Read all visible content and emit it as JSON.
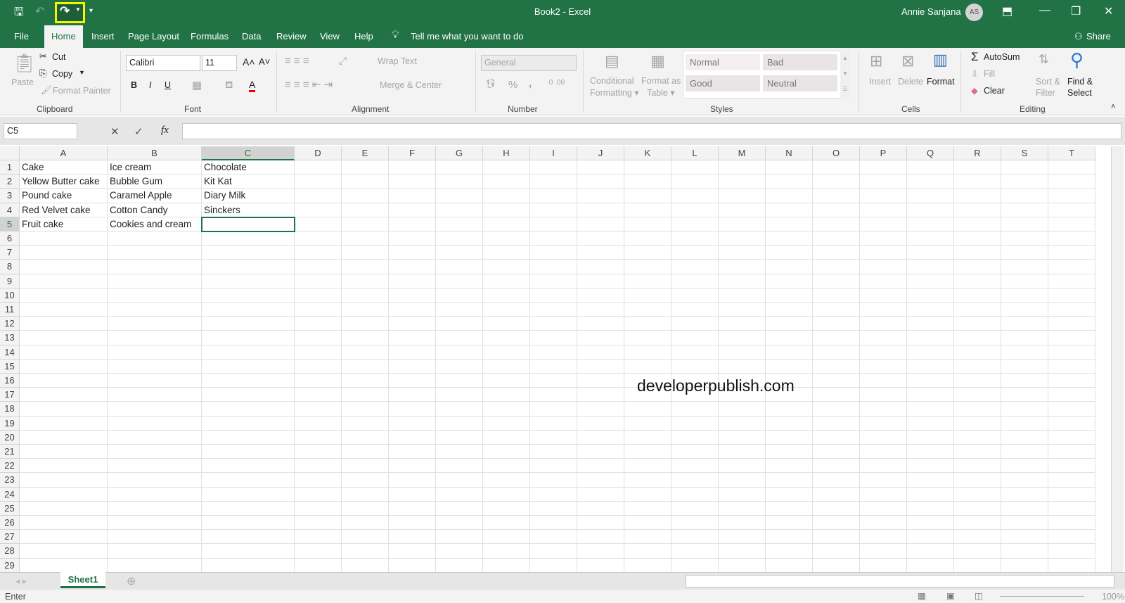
{
  "window": {
    "title": "Book2  -  Excel",
    "user": "Annie Sanjana",
    "initials": "AS",
    "accent": "#217346"
  },
  "qat": {
    "save": "save-icon",
    "undo": "undo-icon",
    "redo": "redo-icon",
    "customize": "▾"
  },
  "tabs": [
    "File",
    "Home",
    "Insert",
    "Page Layout",
    "Formulas",
    "Data",
    "Review",
    "View",
    "Help"
  ],
  "tell_me": "Tell me what you want to do",
  "share": "Share",
  "ribbon": {
    "clipboard": {
      "label": "Clipboard",
      "paste": "Paste",
      "cut": "Cut",
      "copy": "Copy",
      "format_painter": "Format Painter"
    },
    "font": {
      "label": "Font",
      "name": "Calibri",
      "size": "11",
      "bold": "B",
      "italic": "I",
      "underline": "U",
      "color_letter": "A"
    },
    "alignment": {
      "label": "Alignment",
      "wrap": "Wrap Text",
      "merge": "Merge & Center"
    },
    "number": {
      "label": "Number",
      "format": "General",
      "percent": "%",
      "comma": ","
    },
    "styles": {
      "label": "Styles",
      "conditional": "Conditional",
      "formatting": "Formatting ▾",
      "format_as": "Format as",
      "table": "Table ▾",
      "normal": "Normal",
      "bad": "Bad",
      "good": "Good",
      "neutral": "Neutral"
    },
    "cells": {
      "label": "Cells",
      "insert": "Insert",
      "delete": "Delete",
      "format": "Format"
    },
    "editing": {
      "label": "Editing",
      "autosum": "AutoSum",
      "fill": "Fill",
      "clear": "Clear",
      "sort1": "Sort &",
      "sort2": "Filter",
      "find1": "Find &",
      "find2": "Select"
    }
  },
  "formula_bar": {
    "name_box": "C5",
    "cancel": "✕",
    "enter": "✓",
    "fx": "fx",
    "value": ""
  },
  "columns": [
    "A",
    "B",
    "C",
    "D",
    "E",
    "F",
    "G",
    "H",
    "I",
    "J",
    "K",
    "L",
    "M",
    "N",
    "O",
    "P",
    "Q",
    "R",
    "S",
    "T"
  ],
  "rows": [
    [
      "Cake",
      "Ice cream",
      "Chocolate"
    ],
    [
      "Yellow Butter cake",
      "Bubble Gum",
      "Kit Kat"
    ],
    [
      "Pound cake",
      "Caramel Apple",
      "Diary Milk"
    ],
    [
      "Red Velvet cake",
      "Cotton Candy",
      "Sinckers"
    ],
    [
      "Fruit cake",
      "Cookies and cream",
      ""
    ]
  ],
  "row_count": 29,
  "selected_cell": "C5",
  "watermark": "developerpublish.com",
  "sheet_tabs": [
    "Sheet1"
  ],
  "status": {
    "mode": "Enter",
    "zoom": "100%"
  }
}
